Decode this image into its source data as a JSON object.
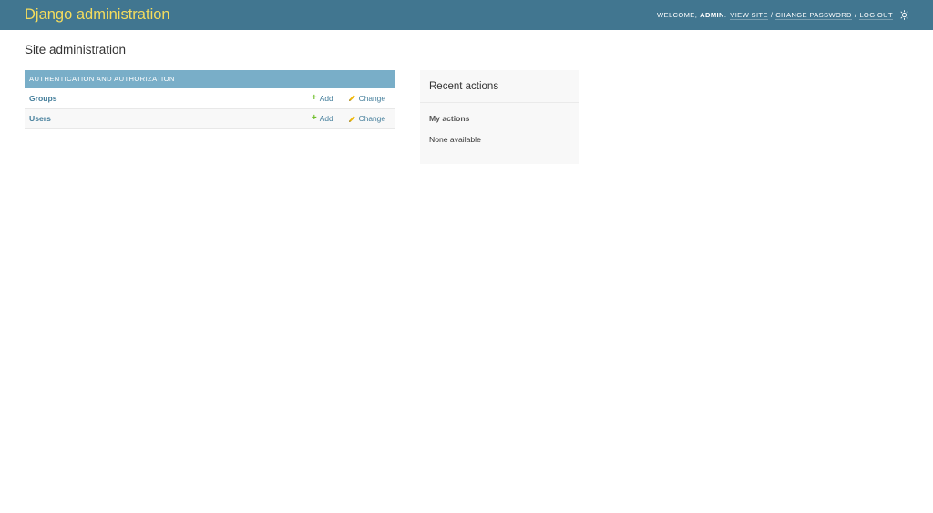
{
  "header": {
    "brand": "Django administration",
    "welcome": "Welcome,",
    "username": "admin",
    "view_site": "View site",
    "change_password": "Change password",
    "log_out": "Log out",
    "separator": "/",
    "theme_icon": "sun-icon"
  },
  "page": {
    "title": "Site administration"
  },
  "app": {
    "caption": "Authentication and Authorization",
    "models": [
      {
        "name": "Groups",
        "add_label": "Add",
        "change_label": "Change"
      },
      {
        "name": "Users",
        "add_label": "Add",
        "change_label": "Change"
      }
    ]
  },
  "recent_actions": {
    "title": "Recent actions",
    "subtitle": "My actions",
    "empty_text": "None available"
  },
  "colors": {
    "header_bg": "#417690",
    "brand": "#f5dd5d",
    "caption_bg": "#79aec8",
    "link": "#447e9b",
    "add_icon": "#70bf2b",
    "change_icon": "#efb80b"
  }
}
